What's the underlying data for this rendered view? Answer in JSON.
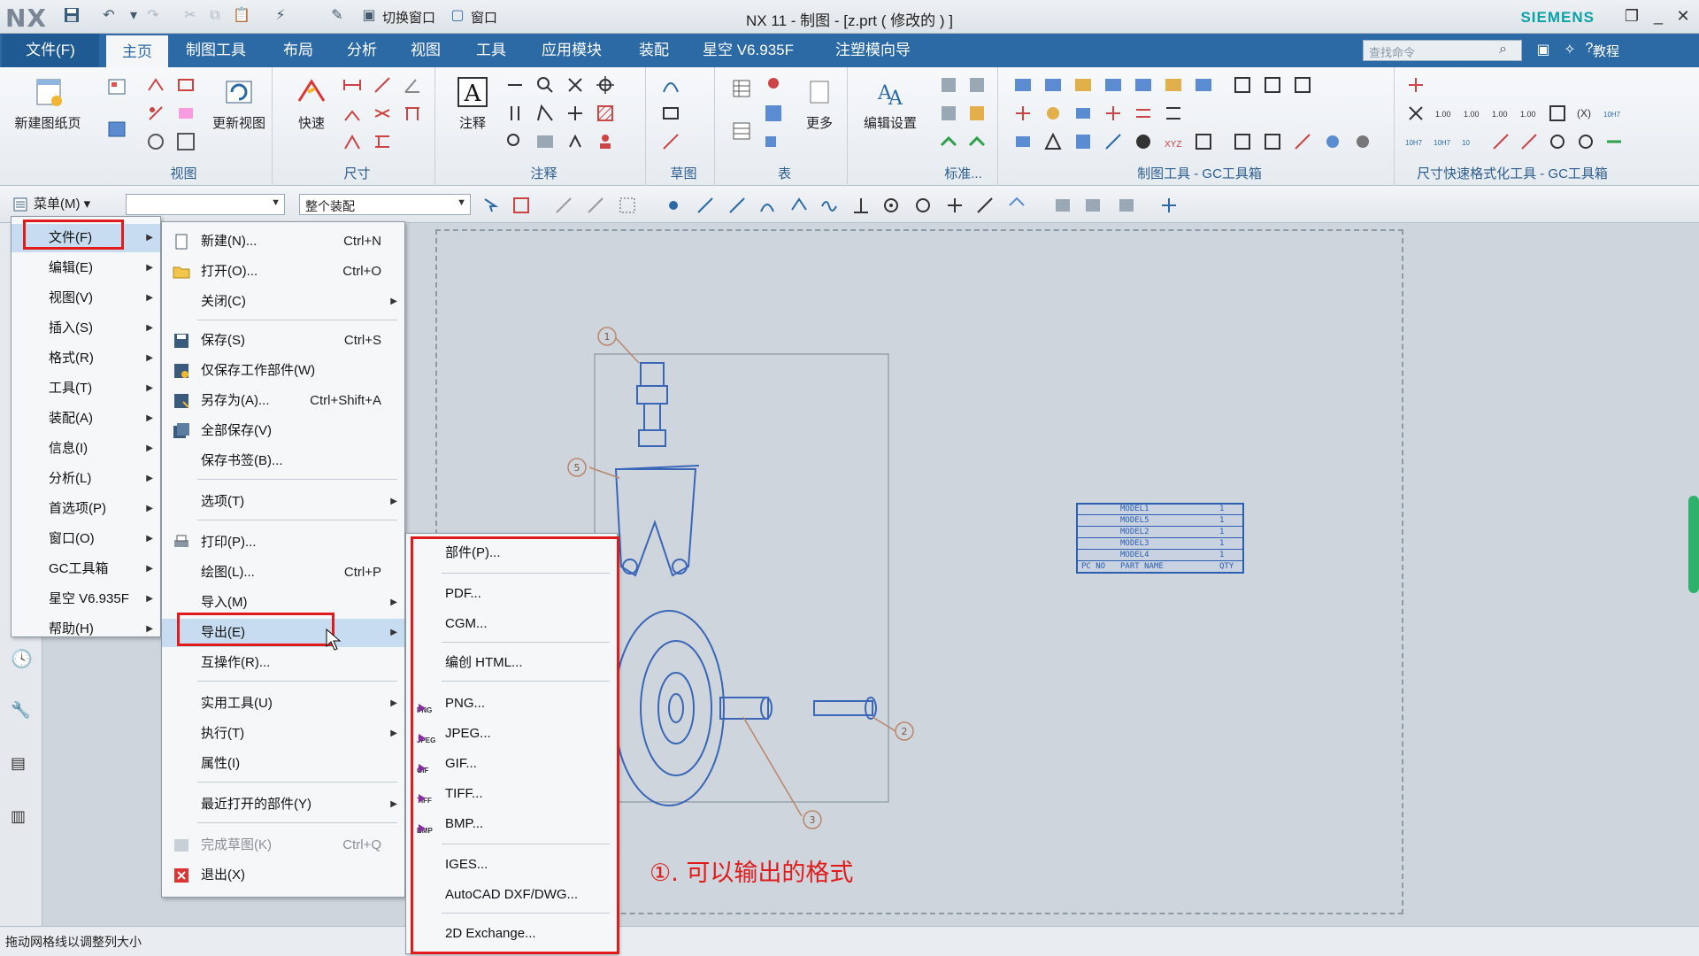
{
  "title_bar": {
    "logo": "NX",
    "switch_window": "切换窗口",
    "window_menu": "窗口",
    "window_title": "NX 11 - 制图 - [z.prt  ( 修改的 ) ]",
    "brand": "SIEMENS"
  },
  "tabs": {
    "file": "文件(F)",
    "items": [
      "主页",
      "制图工具",
      "布局",
      "分析",
      "视图",
      "工具",
      "应用模块",
      "装配",
      "星空 V6.935F",
      "注塑模向导"
    ],
    "search_placeholder": "查找命令",
    "help": "教程"
  },
  "ribbon": {
    "new_sheet": "新建图纸页",
    "update_views": "更新视图",
    "quick": "快速",
    "note": "注释",
    "more": "更多",
    "edit_settings": "编辑设置",
    "groups": {
      "view": "视图",
      "dimension": "尺寸",
      "annotation": "注释",
      "sketch": "草图",
      "table": "表",
      "standard": "标准...",
      "drafting_gc": "制图工具 - GC工具箱",
      "dim_format_gc": "尺寸快速格式化工具 - GC工具箱"
    }
  },
  "toolbar": {
    "menu": "菜单(M)",
    "filter_combo": "",
    "assembly_combo": "整个装配"
  },
  "main_menu": [
    {
      "label": "文件(F)",
      "sub": true
    },
    {
      "label": "编辑(E)",
      "sub": true
    },
    {
      "label": "视图(V)",
      "sub": true
    },
    {
      "label": "插入(S)",
      "sub": true
    },
    {
      "label": "格式(R)",
      "sub": true
    },
    {
      "label": "工具(T)",
      "sub": true
    },
    {
      "label": "装配(A)",
      "sub": true
    },
    {
      "label": "信息(I)",
      "sub": true
    },
    {
      "label": "分析(L)",
      "sub": true
    },
    {
      "label": "首选项(P)",
      "sub": true
    },
    {
      "label": "窗口(O)",
      "sub": true
    },
    {
      "label": "GC工具箱",
      "sub": true
    },
    {
      "label": "星空 V6.935F",
      "sub": true
    },
    {
      "label": "帮助(H)",
      "sub": true
    }
  ],
  "file_menu": [
    {
      "label": "新建(N)...",
      "shortcut": "Ctrl+N"
    },
    {
      "label": "打开(O)...",
      "shortcut": "Ctrl+O"
    },
    {
      "label": "关闭(C)",
      "shortcut": ""
    },
    {
      "label": "保存(S)",
      "shortcut": "Ctrl+S"
    },
    {
      "label": "仅保存工作部件(W)",
      "shortcut": ""
    },
    {
      "label": "另存为(A)...",
      "shortcut": "Ctrl+Shift+A"
    },
    {
      "label": "全部保存(V)",
      "shortcut": ""
    },
    {
      "label": "保存书签(B)...",
      "shortcut": ""
    },
    {
      "label": "选项(T)",
      "shortcut": ""
    },
    {
      "label": "打印(P)...",
      "shortcut": ""
    },
    {
      "label": "绘图(L)...",
      "shortcut": "Ctrl+P"
    },
    {
      "label": "导入(M)",
      "shortcut": ""
    },
    {
      "label": "导出(E)",
      "shortcut": ""
    },
    {
      "label": "互操作(R)...",
      "shortcut": ""
    },
    {
      "label": "实用工具(U)",
      "shortcut": ""
    },
    {
      "label": "执行(T)",
      "shortcut": ""
    },
    {
      "label": "属性(I)",
      "shortcut": ""
    },
    {
      "label": "最近打开的部件(Y)",
      "shortcut": ""
    },
    {
      "label": "完成草图(K)",
      "shortcut": "Ctrl+Q"
    },
    {
      "label": "退出(X)",
      "shortcut": ""
    }
  ],
  "export_menu": [
    {
      "label": "部件(P)...",
      "tag": ""
    },
    {
      "label": "PDF...",
      "tag": ""
    },
    {
      "label": "CGM...",
      "tag": ""
    },
    {
      "label": "编创 HTML...",
      "tag": ""
    },
    {
      "label": "PNG...",
      "tag": "PNG"
    },
    {
      "label": "JPEG...",
      "tag": "JPEG"
    },
    {
      "label": "GIF...",
      "tag": "GIF"
    },
    {
      "label": "TIFF...",
      "tag": "TIFF"
    },
    {
      "label": "BMP...",
      "tag": "BMP"
    },
    {
      "label": "IGES...",
      "tag": ""
    },
    {
      "label": "AutoCAD DXF/DWG...",
      "tag": ""
    },
    {
      "label": "2D Exchange...",
      "tag": ""
    }
  ],
  "annotation": "①. 可以输出的格式",
  "drawing": {
    "balloons": [
      "1",
      "5",
      "2",
      "3"
    ],
    "parts_list": [
      {
        "pc": "",
        "name": "MODEL1",
        "qty": "1"
      },
      {
        "pc": "",
        "name": "MODEL5",
        "qty": "1"
      },
      {
        "pc": "",
        "name": "MODEL2",
        "qty": "1"
      },
      {
        "pc": "",
        "name": "MODEL3",
        "qty": "1"
      },
      {
        "pc": "",
        "name": "MODEL4",
        "qty": "1"
      }
    ],
    "parts_header": {
      "pc": "PC NO",
      "name": "PART NAME",
      "qty": "QTY"
    }
  },
  "status": "拖动网格线以调整列大小",
  "colors": {
    "ribbon_blue": "#2c6aa6",
    "highlight_red": "#e11b1b",
    "drawing_blue": "#2c5fb0"
  }
}
